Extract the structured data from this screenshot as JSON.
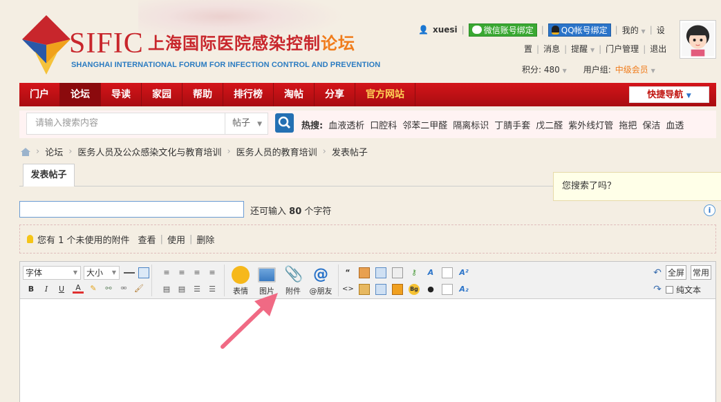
{
  "header": {
    "logo_sific": "SIFIC",
    "logo_cn_main": "上海国际医院感染控制",
    "logo_cn_highlight": "论坛",
    "logo_en": "SHANGHAI INTERNATIONAL FORUM FOR INFECTION CONTROL AND PREVENTION"
  },
  "userbar": {
    "username": "xuesi",
    "wechat_bind": "微信账号绑定",
    "qq_bind": "QQ帐号绑定",
    "mine": "我的",
    "settings_a": "设",
    "settings_b": "置",
    "messages": "消息",
    "reminders": "提醒",
    "portal_admin": "门户管理",
    "logout": "退出",
    "points": "积分: 480",
    "user_group_label": "用户组:",
    "user_group": "中级会员"
  },
  "nav": {
    "items": [
      "门户",
      "论坛",
      "导读",
      "家园",
      "帮助",
      "排行榜",
      "淘帖",
      "分享",
      "官方网站"
    ],
    "quick_nav": "快捷导航"
  },
  "search": {
    "placeholder": "请输入搜索内容",
    "type": "帖子",
    "hot_label": "热搜:",
    "hot_terms": [
      "血液透析",
      "口腔科",
      "邻苯二甲醛",
      "隔离标识",
      "丁腈手套",
      "戊二醛",
      "紫外线灯管",
      "拖把",
      "保洁",
      "血透"
    ]
  },
  "breadcrumb": [
    "论坛",
    "医务人员及公众感染文化与教育培训",
    "医务人员的教育培训",
    "发表帖子"
  ],
  "post": {
    "tab": "发表帖子",
    "tip": "您搜索了吗？",
    "info_icon": "i",
    "remaining_prefix": "还可输入",
    "remaining_count": "80",
    "remaining_suffix": "个字符"
  },
  "attachments": {
    "notice": "您有 1 个未使用的附件",
    "view": "查看",
    "use": "使用",
    "delete": "删除"
  },
  "editor": {
    "font": "字体",
    "size": "大小",
    "emoji": "表情",
    "image": "图片",
    "attachment": "附件",
    "mention": "@朋友",
    "fullscreen": "全屏",
    "common": "常用",
    "plain_text": "纯文本",
    "bold": "B",
    "italic": "I",
    "underline": "U",
    "color": "A",
    "quote": "“",
    "code": "<>"
  },
  "colors": {
    "brand_red": "#c8262c",
    "nav_red": "#c0140f",
    "accent_orange": "#f07c1b",
    "link_blue": "#2b74c9",
    "arrow_pink": "#f06a84"
  }
}
